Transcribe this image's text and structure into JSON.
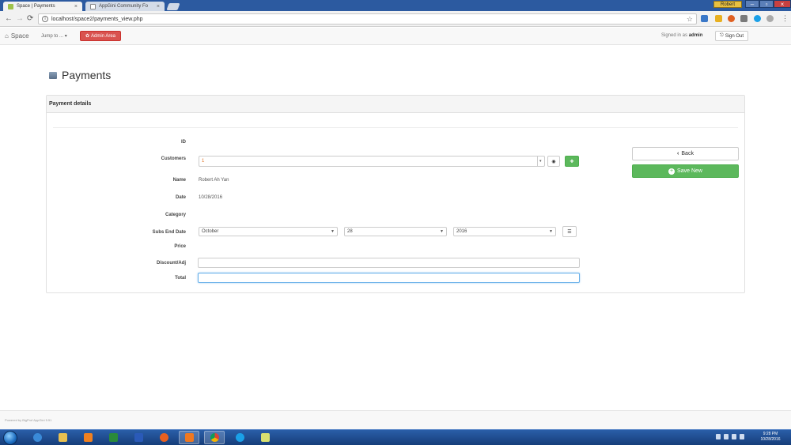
{
  "browser": {
    "tabs": [
      {
        "label": "Space | Payments",
        "active": true
      },
      {
        "label": "AppGini Community Fo",
        "active": false
      }
    ],
    "user_badge": "Robert",
    "url": "localhost/space2/payments_view.php",
    "icons": [
      "back-arrow-icon",
      "forward-arrow-icon",
      "reload-icon",
      "info-icon",
      "star-icon"
    ]
  },
  "navbar": {
    "brand": "Space",
    "jump_to": "Jump to ...",
    "admin_area": "Admin Area",
    "signed_in_prefix": "Signed in as",
    "signed_in_user": "admin",
    "sign_out": "Sign Out"
  },
  "page": {
    "title": "Payments"
  },
  "form": {
    "panel_title": "Payment details",
    "labels": {
      "id": "ID",
      "customers": "Customers",
      "name": "Name",
      "date": "Date",
      "category": "Category",
      "subs_end_date": "Subs End Date",
      "price": "Price",
      "discount": "Discount/Adj",
      "total": "Total"
    },
    "values": {
      "customer_selected": "1",
      "name": "Robert Ah Yan",
      "date": "10/28/2016",
      "subs_month": "October",
      "subs_day": "28",
      "subs_year": "2016"
    },
    "buttons": {
      "back": "Back",
      "save_new": "Save New"
    }
  },
  "footer": {
    "text": "Powered by BigProf AppGini 5.51"
  },
  "taskbar": {
    "time": "9:28 PM",
    "date": "10/28/2016"
  },
  "colors": {
    "danger": "#d9534f",
    "success": "#5cb85c",
    "taskbar": "#1f4f90"
  }
}
